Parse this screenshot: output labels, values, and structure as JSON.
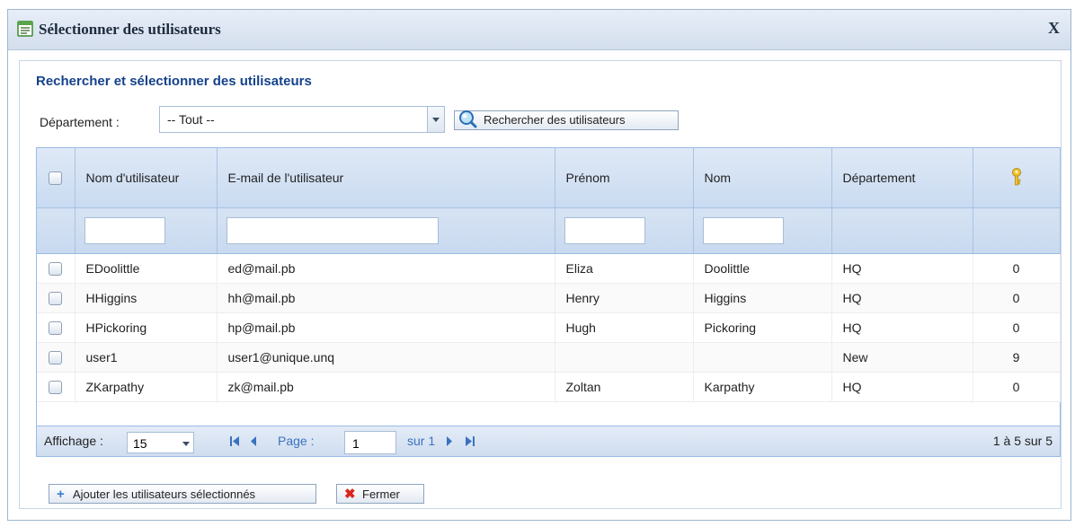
{
  "dialog": {
    "title": "Sélectionner des utilisateurs",
    "close_label": "X"
  },
  "search": {
    "section_title": "Rechercher et sélectionner des utilisateurs",
    "department_label": "Département :",
    "department_value": "-- Tout --",
    "search_button": "Rechercher des utilisateurs"
  },
  "grid": {
    "columns": [
      "Nom d'utilisateur",
      "E-mail de l'utilisateur",
      "Prénom",
      "Nom",
      "Département",
      "key-icon"
    ],
    "rows": [
      {
        "username": "EDoolittle",
        "email": "ed@mail.pb",
        "first": "Eliza",
        "last": "Doolittle",
        "dept": "HQ",
        "keys": "0"
      },
      {
        "username": "HHiggins",
        "email": "hh@mail.pb",
        "first": "Henry",
        "last": "Higgins",
        "dept": "HQ",
        "keys": "0"
      },
      {
        "username": "HPickoring",
        "email": "hp@mail.pb",
        "first": "Hugh",
        "last": "Pickoring",
        "dept": "HQ",
        "keys": "0"
      },
      {
        "username": "user1",
        "email": "user1@unique.unq",
        "first": "",
        "last": "",
        "dept": "New",
        "keys": "9"
      },
      {
        "username": "ZKarpathy",
        "email": "zk@mail.pb",
        "first": "Zoltan",
        "last": "Karpathy",
        "dept": "HQ",
        "keys": "0"
      }
    ]
  },
  "pager": {
    "display_label": "Affichage :",
    "page_size": "15",
    "page_label": "Page :",
    "page_value": "1",
    "of_label": "sur 1",
    "summary": "1 à 5 sur 5"
  },
  "actions": {
    "add_button": "Ajouter les utilisateurs sélectionnés",
    "close_button": "Fermer"
  },
  "colors": {
    "accent": "#15428b",
    "header_bg": "#c9dbf1",
    "add_icon": "#3a7bd5",
    "close_icon": "#d9261c",
    "key_icon": "#f2c230"
  }
}
